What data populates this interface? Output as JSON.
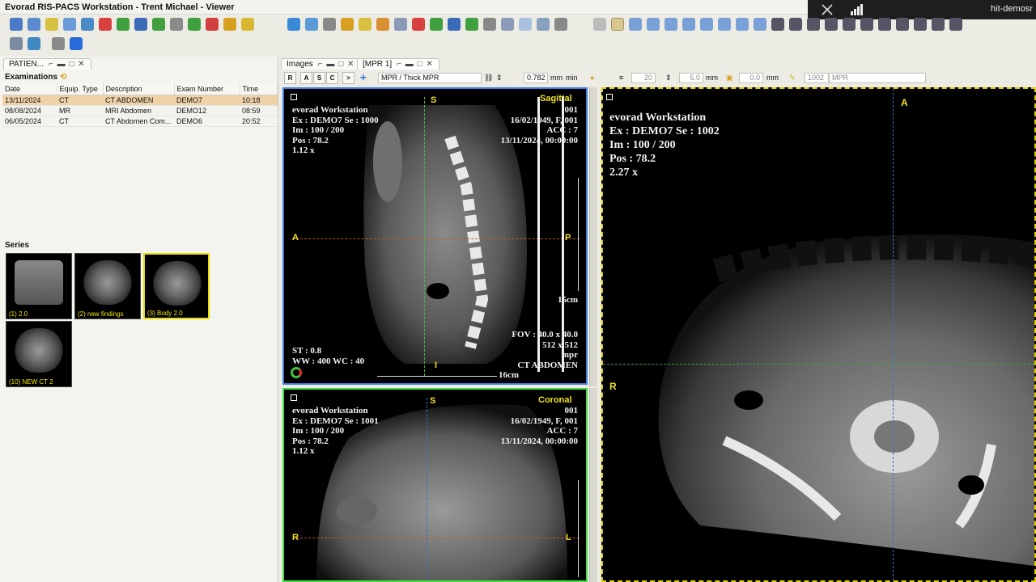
{
  "window": {
    "title": "Evorad RIS-PACS Workstation - Trent Michael - Viewer"
  },
  "remote": {
    "host": "hit-demosr"
  },
  "left_panel": {
    "tab_label": "PATIEN...",
    "examinations_label": "Examinations",
    "columns": [
      "Date",
      "Equip. Type",
      "Description",
      "Exam Number",
      "Time"
    ],
    "rows": [
      [
        "13/11/2024",
        "CT",
        "CT ABDOMEN",
        "DEMO7",
        "10:18"
      ],
      [
        "08/08/2024",
        "MR",
        "MRI Abdomen",
        "DEMO12",
        "08:59"
      ],
      [
        "06/05/2024",
        "CT",
        "CT Abdomen Com...",
        "DEMO6",
        "20:52"
      ]
    ],
    "series_label": "Series",
    "series": [
      {
        "caption": "(1) 2.0"
      },
      {
        "caption": "(2) new findings"
      },
      {
        "caption": "(3) Body 2.0"
      },
      {
        "caption": "(10) NEW CT 2"
      }
    ]
  },
  "viewer": {
    "tabs": [
      "Images",
      "[MPR 1]"
    ],
    "toolbar": {
      "buttons": [
        "R",
        "A",
        "S",
        "C"
      ],
      "mode": "MPR / Thick MPR",
      "thickness": "0.782",
      "thickness_unit": "mm",
      "min_label": "min",
      "field_20": "20",
      "spacing": "5.0",
      "spacing_unit": "mm",
      "offset": "0.0",
      "offset_unit": "mm",
      "series_num": "1002",
      "series_mode": "MPR"
    },
    "sagittal": {
      "station": "evorad Workstation",
      "ex": "Ex : DEMO7   Se : 1000",
      "im": "Im : 100 / 200",
      "pos": "Pos : 78.2",
      "zoom": "1.12 x",
      "orientation": "Sagittal",
      "num": "001",
      "dob": "16/02/1949, F, 001",
      "acc": "ACC : 7",
      "date": "13/11/2024, 00:00:00",
      "top_letter": "S",
      "left_letter": "A",
      "right_letter": "P",
      "bottom_letter": "I",
      "scale_v": "15cm",
      "fov": "FOV : 40.0 x 40.0",
      "matrix": "512 x 512",
      "proc": "mpr",
      "desc": "CT ABDOMEN",
      "st": "ST : 0.8",
      "ww": "WW : 400   WC : 40",
      "scale_h": "16cm"
    },
    "coronal": {
      "station": "evorad Workstation",
      "ex": "Ex : DEMO7   Se : 1001",
      "im": "Im : 100 / 200",
      "pos": "Pos : 78.2",
      "zoom": "1.12 x",
      "orientation": "Coronal",
      "num": "001",
      "dob": "16/02/1949, F, 001",
      "acc": "ACC : 7",
      "date": "13/11/2024, 00:00:00",
      "top_letter": "S",
      "left_letter": "R",
      "right_letter": "L"
    },
    "axial": {
      "station": "evorad Workstation",
      "ex": "Ex : DEMO7   Se : 1002",
      "im": "Im : 100 / 200",
      "pos": "Pos : 78.2",
      "zoom": "2.27 x",
      "top_letter": "A",
      "left_letter": "R"
    }
  }
}
